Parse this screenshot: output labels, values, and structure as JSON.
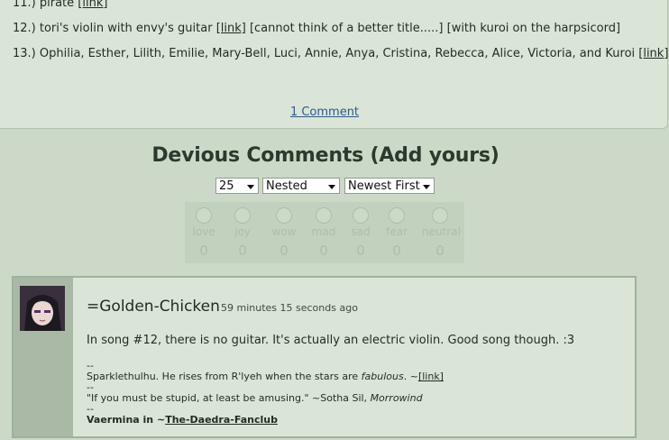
{
  "list": {
    "item11": {
      "text": "11.) pirate ",
      "link": "[link]"
    },
    "item12": {
      "text": "12.) tori's violin with envy's guitar ",
      "link": "[link]",
      "tail": " [cannot think of a better title.....] [with kuroi on the harpsicord]"
    },
    "item13": {
      "text": "13.) Ophilia, Esther, Lilith, Emilie, Mary-Bell, Luci, Annie, Anya, Cristina, Rebecca, Alice, Victoria, and Kuroi ",
      "link": "[link]"
    }
  },
  "comment_count_link": "1 Comment",
  "comments_heading": "Devious Comments (Add yours)",
  "controls": {
    "per_page": "25",
    "view_mode": "Nested",
    "sort_order": "Newest First"
  },
  "moods": [
    {
      "name": "love",
      "count": "0",
      "icon": "love-icon"
    },
    {
      "name": "joy",
      "count": "0",
      "icon": "joy-icon"
    },
    {
      "name": "wow",
      "count": "0",
      "icon": "wow-icon"
    },
    {
      "name": "mad",
      "count": "0",
      "icon": "mad-icon"
    },
    {
      "name": "sad",
      "count": "0",
      "icon": "sad-icon"
    },
    {
      "name": "fear",
      "count": "0",
      "icon": "fear-icon"
    },
    {
      "name": "neutral",
      "count": "0",
      "icon": "neutral-icon"
    }
  ],
  "comment": {
    "author": "=Golden-Chicken",
    "timestamp": "59 minutes 15 seconds ago",
    "body": "In song #12, there is no guitar. It's actually an electric violin. Good song though. :3",
    "sig_sep1": "--",
    "sig_line1": "Sparklethulhu. He rises from R'lyeh when the stars are ",
    "sig_line1_em": "fabulous",
    "sig_line1_end": ". ~",
    "sig_line1_link": "[link]",
    "sig_sep2": "--",
    "sig_line2": "\"If you must be stupid, at least be amusing.\" ~Sotha Sil, ",
    "sig_line2_em": "Morrowind",
    "sig_sep3": "--",
    "sig_line3_prefix": "Vaermina in ~",
    "sig_line3_link": "The-Daedra-Fanclub"
  },
  "colors": {
    "background": "#ccd9c8",
    "panel": "#dbe5d7",
    "link_blue": "#2d5a8c"
  }
}
